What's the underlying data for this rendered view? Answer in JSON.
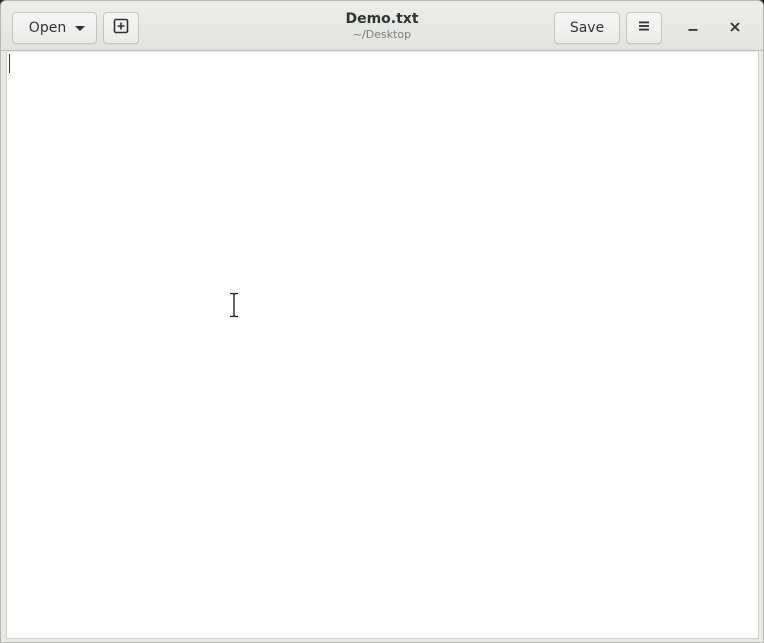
{
  "window": {
    "title": "Demo.txt",
    "subtitle": "~/Desktop"
  },
  "headerbar": {
    "open_label": "Open",
    "open_icon": "chevron-down-icon",
    "new_document_icon": "new-document-icon",
    "save_label": "Save",
    "menu_icon": "hamburger-menu-icon",
    "minimize_icon": "minimize-icon",
    "close_icon": "close-icon"
  },
  "editor": {
    "content": ""
  }
}
